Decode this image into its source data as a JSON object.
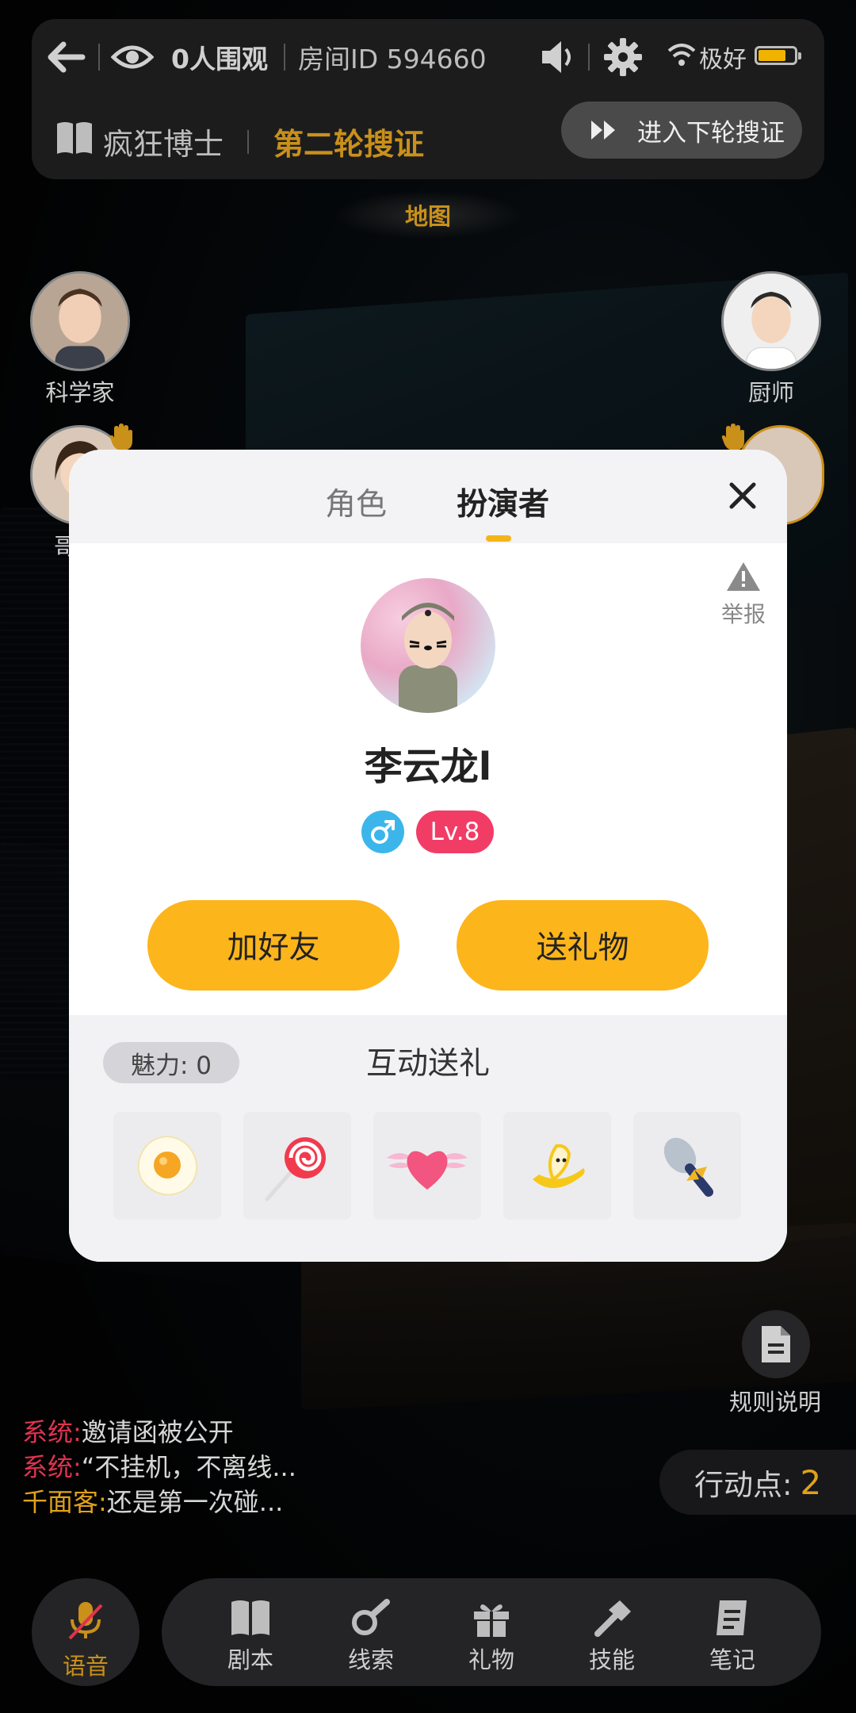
{
  "header": {
    "viewers": "0人围观",
    "room_id": "房间ID 594660",
    "signal": "极好",
    "battery_level": 0.7,
    "script_name": "疯狂博士",
    "round": "第二轮搜证",
    "next_round_button": "进入下轮搜证"
  },
  "map_label": "地图",
  "players": {
    "left_top": "科学家",
    "right_top": "厨师",
    "left_second": "哥"
  },
  "modal": {
    "tabs": [
      "角色",
      "扮演者"
    ],
    "active_tab": "扮演者",
    "report_label": "举报",
    "user": {
      "name": "李云龙l",
      "gender": "male",
      "level": "Lv.8"
    },
    "add_friend_button": "加好友",
    "send_gift_button": "送礼物",
    "charm": "魅力: 0",
    "interact_title": "互动送礼",
    "gifts": [
      "egg-icon",
      "lollipop-icon",
      "winged-heart-icon",
      "banana-icon",
      "microphone-icon"
    ]
  },
  "rules_label": "规则说明",
  "chat": [
    {
      "sender": "系统:",
      "text": "邀请函被公开",
      "type": "system"
    },
    {
      "sender": "系统:",
      "text": "“不挂机，不离线...",
      "type": "system"
    },
    {
      "sender": "千面客:",
      "text": "还是第一次碰...",
      "type": "user"
    }
  ],
  "action_points": {
    "label": "行动点:",
    "value": "2"
  },
  "bottom_nav": {
    "voice": "语音",
    "items": [
      "剧本",
      "线索",
      "礼物",
      "技能",
      "笔记"
    ]
  },
  "colors": {
    "accent_gold": "#c9901a",
    "button_yellow": "#fdb51c",
    "level_pink": "#f13c66",
    "gender_blue": "#3cb6ea",
    "system_red": "#e0334f"
  }
}
